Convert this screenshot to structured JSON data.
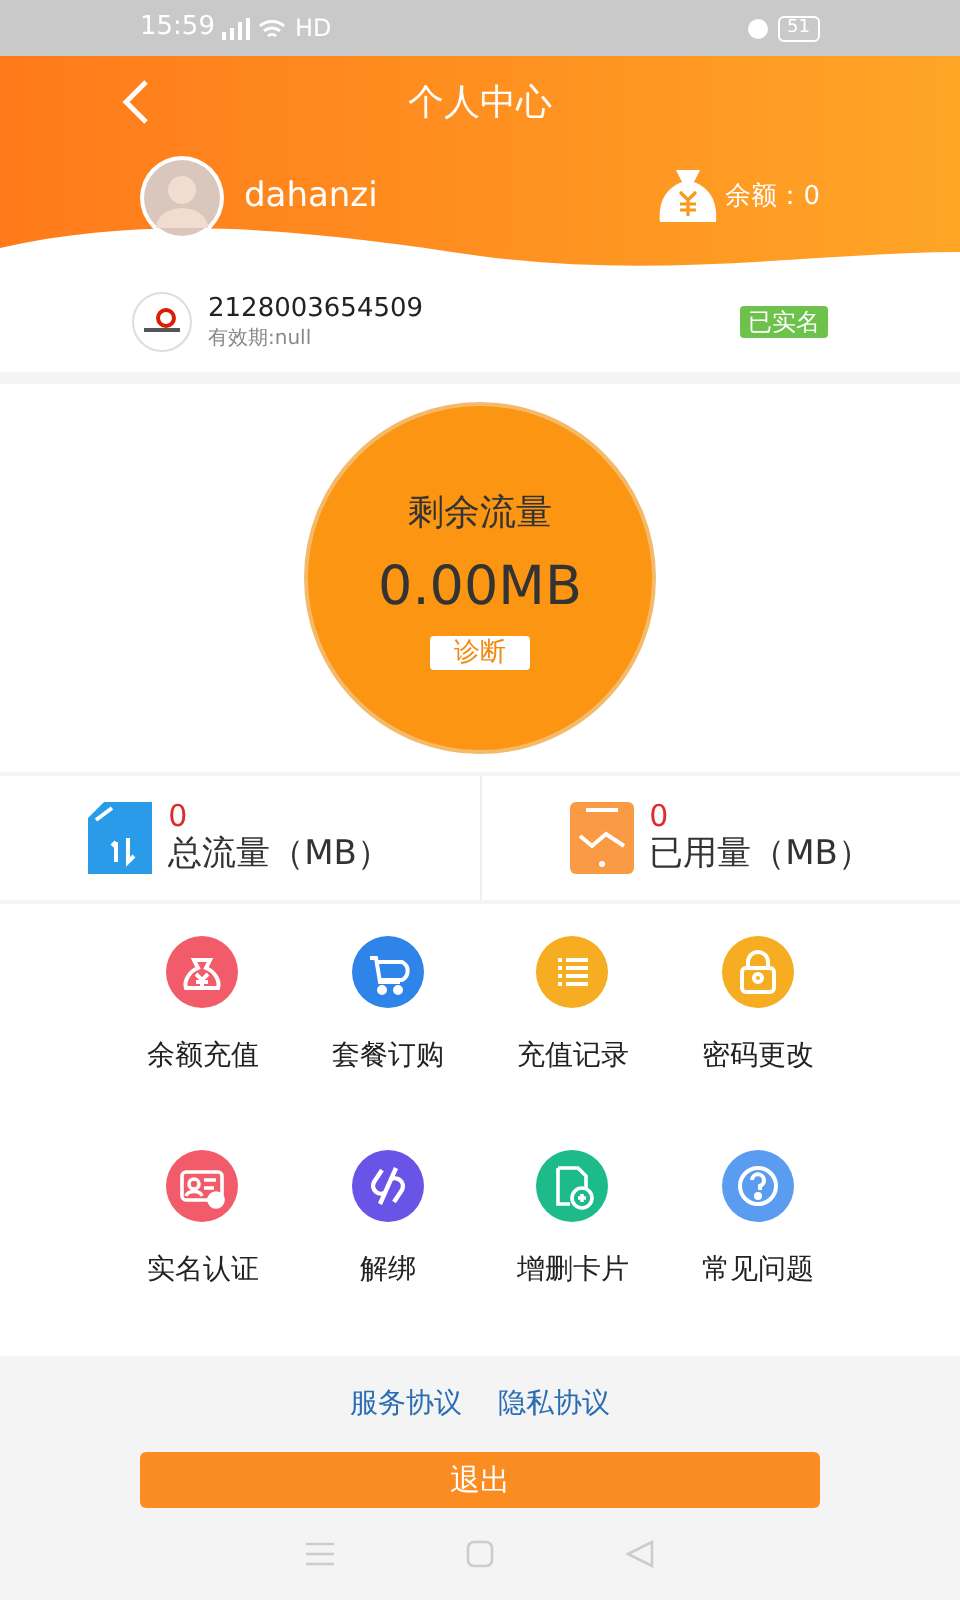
{
  "status_bar": {
    "time": "15:59",
    "network": "HD",
    "battery": "51"
  },
  "header": {
    "title": "个人中心",
    "username": "dahanzi",
    "balance": "余额：0"
  },
  "card": {
    "number": "2128003654509",
    "validity": "有效期:null",
    "badge": "已实名"
  },
  "flow": {
    "title": "剩余流量",
    "value": "0.00MB",
    "button": "诊断"
  },
  "stats": [
    {
      "kind": "total",
      "value": "0",
      "label": "总流量（MB）"
    },
    {
      "kind": "used",
      "value": "0",
      "label": "已用量（MB）"
    }
  ],
  "menu": [
    {
      "kind": "recharge",
      "label": "余额充值",
      "color": "#f25c6a"
    },
    {
      "kind": "package",
      "label": "套餐订购",
      "color": "#2f84ea"
    },
    {
      "kind": "records",
      "label": "充值记录",
      "color": "#f7ad22"
    },
    {
      "kind": "password",
      "label": "密码更改",
      "color": "#f7ad22"
    },
    {
      "kind": "verify",
      "label": "实名认证",
      "color": "#f25c6a"
    },
    {
      "kind": "unbind",
      "label": "解绑",
      "color": "#6a54e8"
    },
    {
      "kind": "cards",
      "label": "增删卡片",
      "color": "#1dba8a"
    },
    {
      "kind": "faq",
      "label": "常见问题",
      "color": "#5a9df0"
    }
  ],
  "links": [
    "服务协议",
    "隐私协议"
  ],
  "logout_button": "退出"
}
